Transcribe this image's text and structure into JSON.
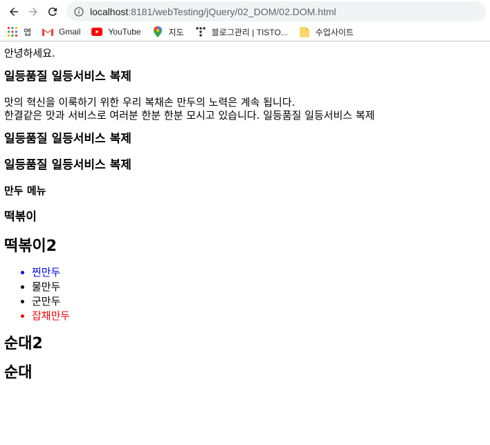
{
  "browser": {
    "url_host": "localhost",
    "url_rest": ":8181/webTesting/jQuery/02_DOM/02.DOM.html"
  },
  "bookmarks": [
    {
      "label": "앱",
      "icon": "apps-grid-icon"
    },
    {
      "label": "Gmail",
      "icon": "gmail-icon"
    },
    {
      "label": "YouTube",
      "icon": "youtube-icon"
    },
    {
      "label": "지도",
      "icon": "maps-pin-icon"
    },
    {
      "label": "블로그관리 | TISTO...",
      "icon": "tistory-icon"
    },
    {
      "label": "수업사이트",
      "icon": "folder-icon"
    }
  ],
  "page": {
    "greeting": "안녕하세요.",
    "heading1": "일등품질 일등서비스 복제",
    "paragraph_line1": "맛의 혁신을 이룩하기 위한 우리 복채손 만두의 노력은 계속 됩니다.",
    "paragraph_line2": "한결같은 맛과 서비스로 여러분 한분 한분 모시고 있습니다. 일등품질 일등서비스 복제",
    "heading2": "일등품질 일등서비스 복제",
    "heading3": "일등품질 일등서비스 복제",
    "menu_title": "만두 메뉴",
    "tteok1": "떡볶이",
    "tteok2": "떡볶이2",
    "menu_items": [
      "찐만두",
      "물만두",
      "군만두",
      "잡채만두"
    ],
    "sundae2": "순대2",
    "sundae": "순대"
  },
  "colors": {
    "item_blue": "#0000ff",
    "item_red": "#ff0000"
  }
}
